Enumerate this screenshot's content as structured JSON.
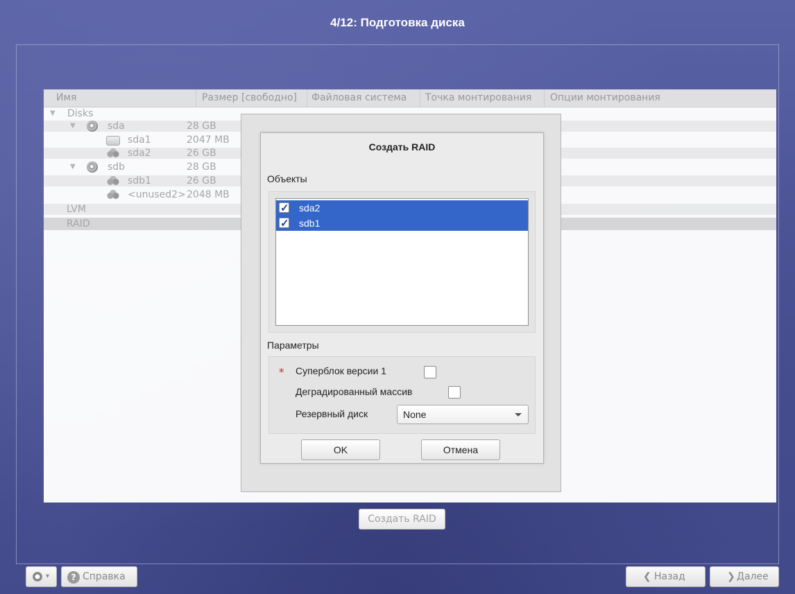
{
  "window": {
    "title": "4/12: Подготовка диска"
  },
  "table": {
    "columns": [
      "Имя",
      "Размер [свободно]",
      "Файловая система",
      "Точка монтирования",
      "Опции монтирования"
    ],
    "rows": [
      {
        "name": "Disks",
        "size": "",
        "icon": "disks-group",
        "expander": "▼"
      },
      {
        "name": "sda",
        "size": "28 GB",
        "icon": "disk-icon",
        "expander": "▼"
      },
      {
        "name": "sda1",
        "size": "2047 MB",
        "icon": "partition-icon"
      },
      {
        "name": "sda2",
        "size": "26 GB",
        "icon": "raid-member-icon"
      },
      {
        "name": "sdb",
        "size": "28 GB",
        "icon": "disk-icon",
        "expander": "▼"
      },
      {
        "name": "sdb1",
        "size": "26 GB",
        "icon": "raid-member-icon"
      },
      {
        "name": "<unused2>",
        "size": "2048 MB",
        "icon": "raid-member-icon"
      },
      {
        "name": "LVM",
        "size": ""
      },
      {
        "name": "RAID",
        "size": "",
        "selected": true
      }
    ]
  },
  "create_raid_button": "Создать RAID",
  "dialog": {
    "title": "Создать RAID",
    "objects_label": "Объекты",
    "objects": [
      {
        "label": "sda2",
        "checked": true
      },
      {
        "label": "sdb1",
        "checked": true
      }
    ],
    "params_label": "Параметры",
    "superblock_label": "Суперблок версии 1",
    "superblock_required_mark": "*",
    "superblock_checked": false,
    "degraded_label": "Деградированный массив",
    "degraded_checked": false,
    "spare_label": "Резервный диск",
    "spare_value": "None",
    "ok_label": "OK",
    "cancel_label": "Отмена"
  },
  "bottom": {
    "help_label": "Справка",
    "back_label": "Назад",
    "back_glyph": "❮",
    "next_label": "Далее",
    "next_glyph": "❯",
    "help_glyph": "?",
    "menu_arrow": "▾"
  },
  "colors": {
    "selection": "#3366c8",
    "background": "#4d5598",
    "required": "#d62020"
  }
}
